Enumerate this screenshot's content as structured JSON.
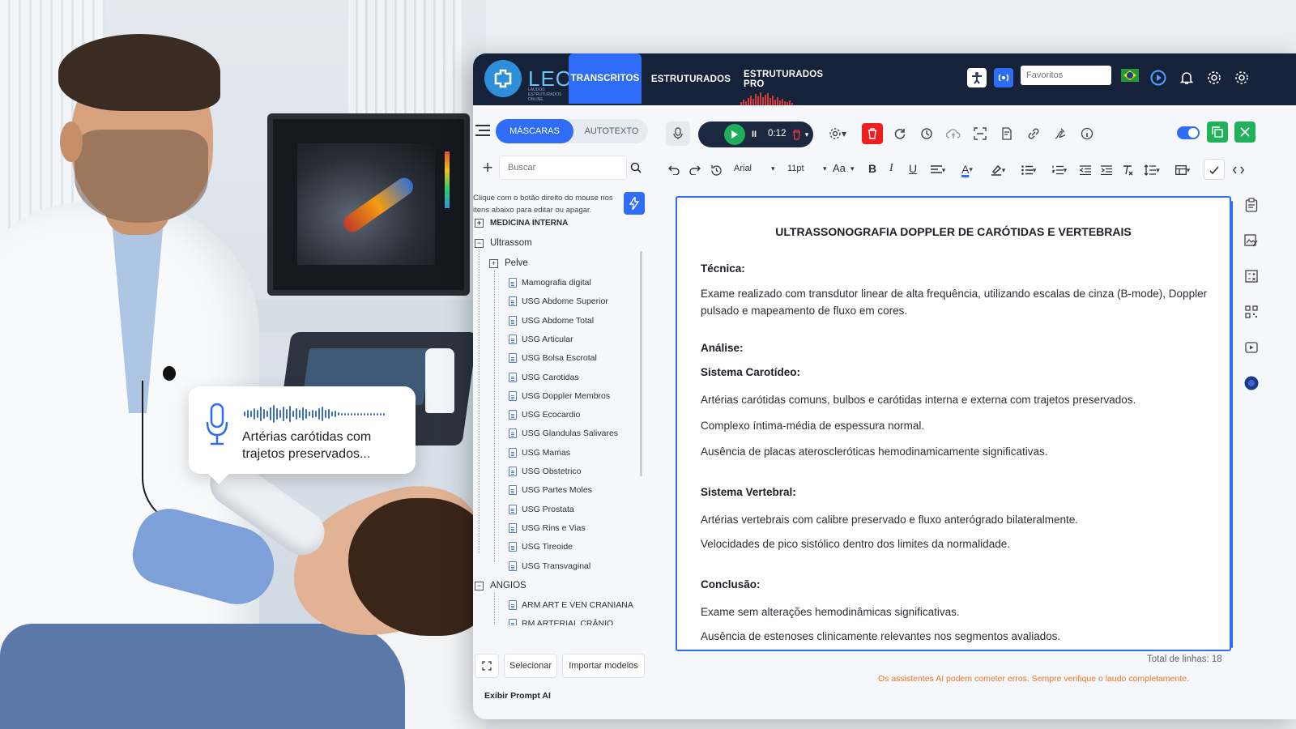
{
  "bubble": {
    "text": "Artérias carótidas com trajetos preservados..."
  },
  "app": {
    "logo_text": "LEO",
    "logo_subtitle": "LAUDOS ESTRUTURADOS ONLINE",
    "nav_tabs": [
      {
        "label": "TRANSCRITOS",
        "active": true
      },
      {
        "label": "ESTRUTURADOS",
        "active": false
      },
      {
        "label": "ESTRUTURADOS PRO",
        "active": false
      }
    ],
    "favorites_placeholder": "Favoritos",
    "accent_color": "#2f6df6",
    "topbar_color": "#16213a"
  },
  "sidebar": {
    "tabs": [
      "MÁSCARAS",
      "AUTOTEXTO"
    ],
    "search_placeholder": "Buscar",
    "hint": "Clique com o botão direito do mouse nos itens abaixo para editar ou apagar.",
    "tree": {
      "categories": [
        {
          "label": "MEDICINA INTERNA",
          "expanded": false
        },
        {
          "label": "Ultrassom",
          "expanded": true
        },
        {
          "label": "ANGIOS",
          "expanded": true
        }
      ],
      "group": {
        "label": "Pelve",
        "expanded": false
      },
      "ultrassom_items": [
        "Mamografia digital",
        "USG Abdome Superior",
        "USG Abdome Total",
        "USG Articular",
        "USG Bolsa Escrotal",
        "USG Carotidas",
        "USG Doppler Membros",
        "USG Ecocardio",
        "USG Glandulas Salivares",
        "USG Mamas",
        "USG Obstetrico",
        "USG Partes Moles",
        "USG Prostata",
        "USG Rins e Vias",
        "USG Tireoide",
        "USG Transvaginal"
      ],
      "angios_items": [
        "ARM ART E VEN CRANIANA",
        "RM ARTERIAL CRÂNIO"
      ]
    },
    "buttons": {
      "select": "Selecionar",
      "import": "Importar modelos"
    },
    "prompt_label": "Exibir Prompt AI"
  },
  "toolbar": {
    "timer": "0:12",
    "font_family": "Arial",
    "font_size": "11pt",
    "case_label": "Aa",
    "bold": "B",
    "italic": "I",
    "underline": "U",
    "text_color": "A"
  },
  "document": {
    "title": "ULTRASSONOGRAFIA DOPPLER DE CARÓTIDAS E VERTEBRAIS",
    "tecnica_heading": "Técnica:",
    "tecnica_text": "Exame realizado com transdutor linear de alta frequência, utilizando escalas de cinza (B-mode), Doppler pulsado e mapeamento de fluxo em cores.",
    "analise_heading": "Análise:",
    "carotideo_heading": "Sistema Carotídeo:",
    "carotideo_lines": [
      "Artérias carótidas comuns, bulbos e carótidas interna e externa com trajetos preservados.",
      "Complexo íntima-média de espessura normal.",
      "Ausência de placas ateroscleróticas hemodinamicamente significativas."
    ],
    "vertebral_heading": "Sistema Vertebral:",
    "vertebral_lines": [
      "Artérias vertebrais com calibre preservado e fluxo anterógrado bilateralmente.",
      "Velocidades de pico sistólico dentro dos limites da normalidade."
    ],
    "conclusao_heading": "Conclusão:",
    "conclusao_lines": [
      "Exame sem alterações hemodinâmicas significativas.",
      "Ausência de estenoses clinicamente relevantes nos segmentos avaliados."
    ],
    "total_lines": "Total de linhas: 18",
    "warning": "Os assistentes AI podem cometer erros. Sempre verifique o laudo completamente."
  },
  "icons": {
    "rail": [
      "clipboard-icon",
      "image-edit-icon",
      "calculator-icon",
      "qr-code-icon",
      "video-icon",
      "ai-icon"
    ]
  }
}
